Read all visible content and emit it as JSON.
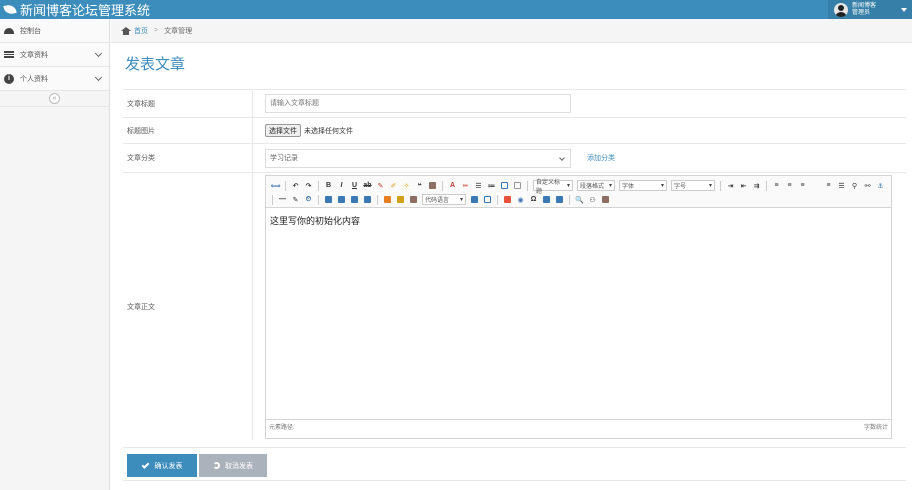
{
  "app": {
    "title": "新闻博客论坛管理系统"
  },
  "user": {
    "line1": "新闻博客",
    "line2": "管理员"
  },
  "sidebar": {
    "items": [
      {
        "label": "控制台",
        "icon": "dashboard-icon"
      },
      {
        "label": "文章资料",
        "icon": "list-icon",
        "has_chevron": true
      },
      {
        "label": "个人资料",
        "icon": "info-icon",
        "has_chevron": true
      }
    ],
    "collapse_label": "«"
  },
  "breadcrumb": {
    "home": "首页",
    "current": "文章管理"
  },
  "page": {
    "title": "发表文章"
  },
  "form": {
    "title_label": "文章标题",
    "title_placeholder": "请输入文章标题",
    "image_label": "标题图片",
    "file_button": "选择文件",
    "file_status": "未选择任何文件",
    "category_label": "文章分类",
    "category_value": "学习记录",
    "add_category": "添加分类",
    "content_label": "文章正文"
  },
  "editor": {
    "content": "这里写你的初始化内容",
    "footer_left": "元素路径:",
    "footer_right": "字数统计",
    "dropdowns": {
      "style": "自定义标题",
      "para": "段落格式",
      "font": "字体",
      "size": "字号",
      "code": "代码语言"
    },
    "colors": {
      "font": "#c0392b",
      "bg": "#d4a017",
      "table": "#e8503a",
      "image": "#3c78b4"
    }
  },
  "buttons": {
    "submit": "确认发表",
    "reset": "取消发表"
  },
  "colors": {
    "primary": "#3c8dbc",
    "topbar": "#3c8dbc",
    "secondary_button": "#aab2bb"
  }
}
